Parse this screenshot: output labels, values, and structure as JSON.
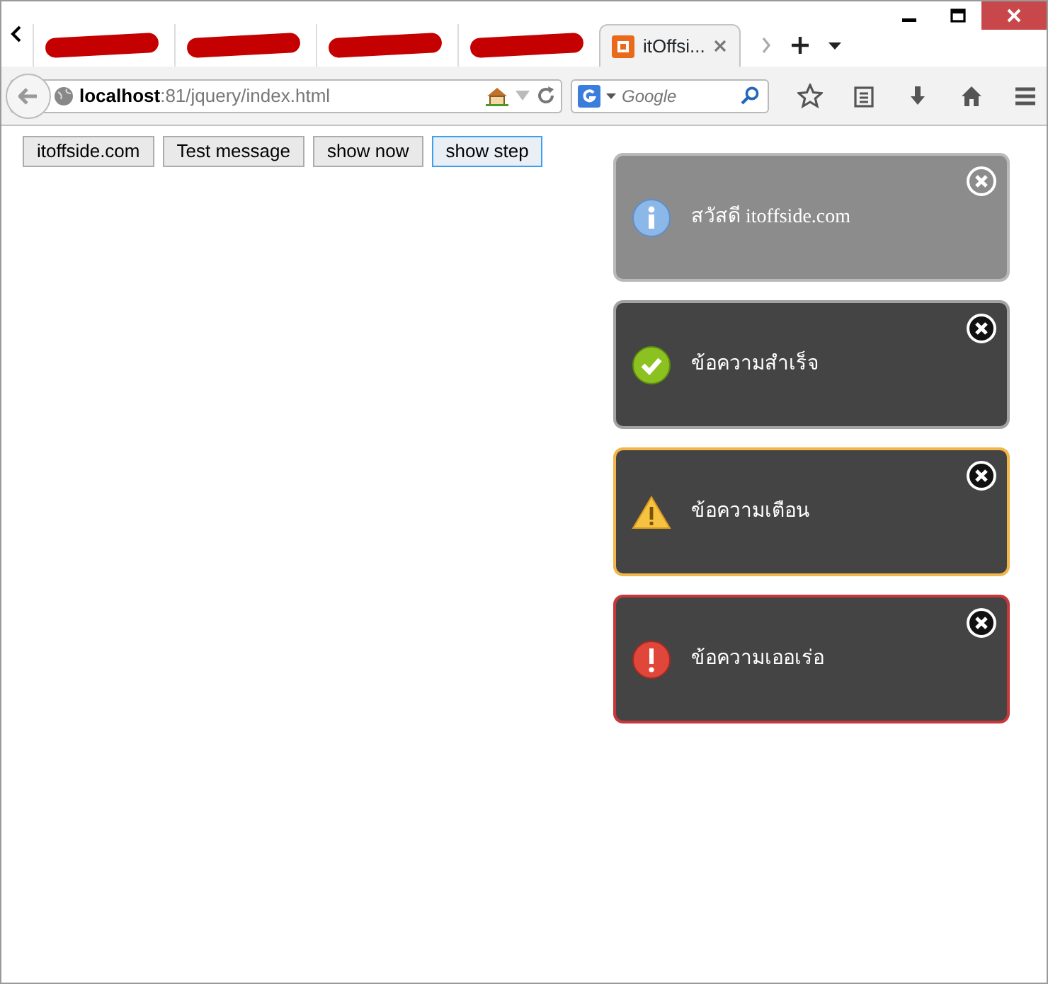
{
  "tabs": [
    {
      "redacted": true,
      "selected": false
    },
    {
      "redacted": true,
      "selected": false
    },
    {
      "redacted": true,
      "selected": false
    },
    {
      "redacted": true,
      "selected": false
    },
    {
      "label": "itOffsi...",
      "redacted": false,
      "selected": true
    }
  ],
  "address_bar": {
    "url": "**localhost**:81/jquery/index.html"
  },
  "search_field": {
    "placeholder": "Google"
  },
  "buttons": [
    {
      "label": "itoffside.com",
      "focused": false
    },
    {
      "label": "Test message",
      "focused": false
    },
    {
      "label": "show now",
      "focused": false
    },
    {
      "label": "show step",
      "focused": true
    }
  ],
  "notifications": [
    {
      "kind": "info",
      "message": "สวัสดี itoffside.com"
    },
    {
      "kind": "success",
      "message": "ข้อความสำเร็จ"
    },
    {
      "kind": "warning",
      "message": "ข้อความเตือน"
    },
    {
      "kind": "error",
      "message": "ข้อความเออเร่อ"
    }
  ]
}
